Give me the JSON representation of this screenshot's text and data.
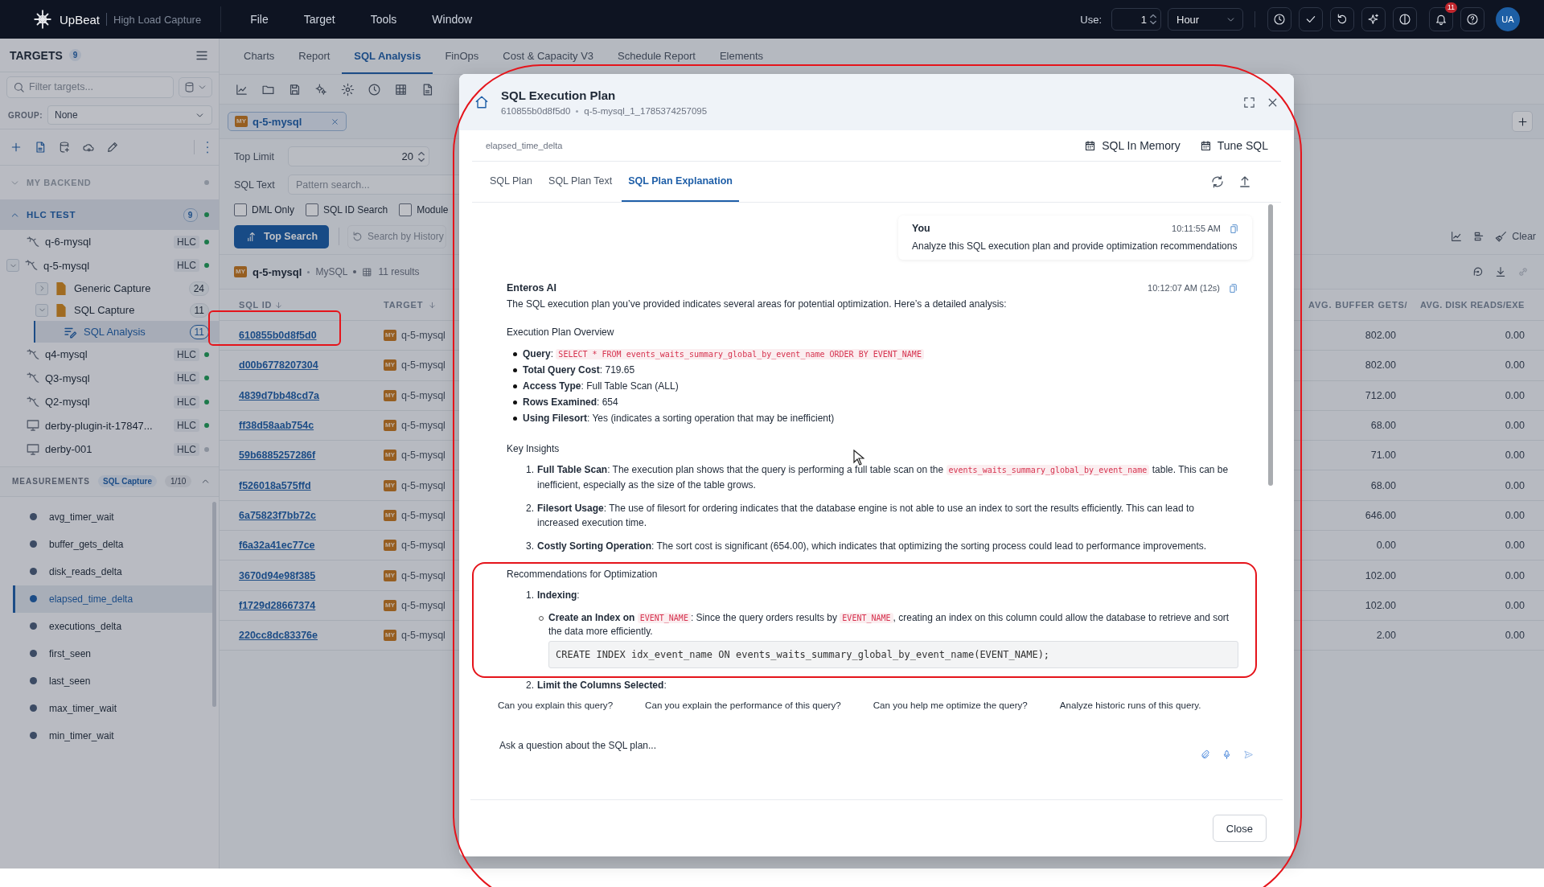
{
  "app": {
    "name": "UpBeat",
    "subtitle": "High Load Capture",
    "menu": [
      "File",
      "Target",
      "Tools",
      "Window"
    ]
  },
  "top_bar": {
    "use_label": "Use:",
    "use_value": "1",
    "unit": "Hour",
    "notifications": "11",
    "avatar": "UA"
  },
  "sidebar": {
    "title": "TARGETS",
    "count": "9",
    "filter_placeholder": "Filter targets...",
    "group_label": "GROUP:",
    "group_value": "None",
    "sections": [
      {
        "label": "MY BACKEND",
        "expanded": false,
        "online": false
      },
      {
        "label": "HLC TEST",
        "expanded": true,
        "count": "9",
        "online": true,
        "targets": [
          {
            "kind": "mysql",
            "name": "q-6-mysql",
            "badge": "HLC",
            "online": true
          },
          {
            "kind": "mysql",
            "name": "q-5-mysql",
            "badge": "HLC",
            "online": true,
            "expanded": true,
            "children": [
              {
                "kind": "capture",
                "name": "Generic Capture",
                "count": "24",
                "expanded": false
              },
              {
                "kind": "capture",
                "name": "SQL Capture",
                "count": "11",
                "expanded": true,
                "children": [
                  {
                    "kind": "analysis",
                    "name": "SQL Analysis",
                    "count": "11",
                    "selected": true
                  }
                ]
              }
            ]
          },
          {
            "kind": "mysql",
            "name": "q4-mysql",
            "badge": "HLC",
            "online": true
          },
          {
            "kind": "mysql",
            "name": "Q3-mysql",
            "badge": "HLC",
            "online": true
          },
          {
            "kind": "mysql",
            "name": "Q2-mysql",
            "badge": "HLC",
            "online": true
          },
          {
            "kind": "monitor",
            "name": "derby-plugin-it-17847...",
            "badge": "HLC",
            "online": true
          },
          {
            "kind": "monitor",
            "name": "derby-001",
            "badge": "HLC",
            "online": false
          }
        ]
      }
    ]
  },
  "measurements": {
    "label": "MEASUREMENTS",
    "capture": "SQL Capture",
    "count": "1/10",
    "items": [
      {
        "name": "avg_timer_wait",
        "selected": false
      },
      {
        "name": "buffer_gets_delta",
        "selected": false
      },
      {
        "name": "disk_reads_delta",
        "selected": false
      },
      {
        "name": "elapsed_time_delta",
        "selected": true
      },
      {
        "name": "executions_delta",
        "selected": false
      },
      {
        "name": "first_seen",
        "selected": false
      },
      {
        "name": "last_seen",
        "selected": false
      },
      {
        "name": "max_timer_wait",
        "selected": false
      },
      {
        "name": "min_timer_wait",
        "selected": false
      }
    ]
  },
  "tabs": [
    {
      "label": "Charts",
      "selected": false
    },
    {
      "label": "Report",
      "selected": false
    },
    {
      "label": "SQL Analysis",
      "selected": true
    },
    {
      "label": "FinOps",
      "selected": false
    },
    {
      "label": "Cost & Capacity V3",
      "selected": false
    },
    {
      "label": "Schedule Report",
      "selected": false
    },
    {
      "label": "Elements",
      "selected": false
    }
  ],
  "query_tag": {
    "db": "MY",
    "name": "q-5-mysql"
  },
  "filters": {
    "top_limit_label": "Top Limit",
    "top_limit": "20",
    "sql_text_label": "SQL Text",
    "sql_text_placeholder": "Pattern search...",
    "checkboxes": [
      {
        "label": "DML Only",
        "checked": false
      },
      {
        "label": "SQL ID Search",
        "checked": false
      },
      {
        "label": "Module",
        "checked": false
      }
    ],
    "search_button": "Top Search",
    "history_button": "Search by History",
    "clear_button": "Clear"
  },
  "results": {
    "db": "MY",
    "target": "q-5-mysql",
    "engine": "MySQL",
    "count": "11 results",
    "columns": [
      "SQL ID",
      "TARGET",
      "AVG. BUFFER GETS/",
      "AVG. DISK READS/EXE"
    ],
    "rows": [
      {
        "sql_id": "610855b0d8f5d0",
        "db": "MY",
        "target": "q-5-mysql",
        "avg_buffer_gets": "802.00",
        "avg_disk_reads": "0.00"
      },
      {
        "sql_id": "d00b6778207304",
        "db": "MY",
        "target": "q-5-mysql",
        "avg_buffer_gets": "802.00",
        "avg_disk_reads": "0.00"
      },
      {
        "sql_id": "4839d7bb48cd7a",
        "db": "MY",
        "target": "q-5-mysql",
        "avg_buffer_gets": "712.00",
        "avg_disk_reads": "0.00"
      },
      {
        "sql_id": "ff38d58aab754c",
        "db": "MY",
        "target": "q-5-mysql",
        "avg_buffer_gets": "68.00",
        "avg_disk_reads": "0.00"
      },
      {
        "sql_id": "59b6885257286f",
        "db": "MY",
        "target": "q-5-mysql",
        "avg_buffer_gets": "71.00",
        "avg_disk_reads": "0.00"
      },
      {
        "sql_id": "f526018a575ffd",
        "db": "MY",
        "target": "q-5-mysql",
        "avg_buffer_gets": "68.00",
        "avg_disk_reads": "0.00"
      },
      {
        "sql_id": "6a75823f7bb72c",
        "db": "MY",
        "target": "q-5-mysql",
        "avg_buffer_gets": "646.00",
        "avg_disk_reads": "0.00"
      },
      {
        "sql_id": "f6a32a41ec77ce",
        "db": "MY",
        "target": "q-5-mysql",
        "avg_buffer_gets": "0.00",
        "avg_disk_reads": "0.00"
      },
      {
        "sql_id": "3670d94e98f385",
        "db": "MY",
        "target": "q-5-mysql",
        "avg_buffer_gets": "102.00",
        "avg_disk_reads": "0.00"
      },
      {
        "sql_id": "f1729d28667374",
        "db": "MY",
        "target": "q-5-mysql",
        "avg_buffer_gets": "102.00",
        "avg_disk_reads": "0.00"
      },
      {
        "sql_id": "220cc8dc83376e",
        "db": "MY",
        "target": "q-5-mysql",
        "avg_buffer_gets": "2.00",
        "avg_disk_reads": "0.00"
      }
    ]
  },
  "modal": {
    "title": "SQL Execution Plan",
    "sql_id": "610855b0d8f5d0",
    "source": "q-5-mysql_1_1785374257095",
    "metric": "elapsed_time_delta",
    "actions": [
      "SQL In Memory",
      "Tune SQL"
    ],
    "tabs": [
      {
        "label": "SQL Plan",
        "selected": false
      },
      {
        "label": "SQL Plan Text",
        "selected": false
      },
      {
        "label": "SQL Plan Explanation",
        "selected": true
      }
    ],
    "messages": [
      {
        "kind": "user",
        "author": "You",
        "time": "10:11:55 AM",
        "text": "Analyze this SQL execution plan and provide optimization recommendations"
      },
      {
        "kind": "ai",
        "author": "Enteros AI",
        "time": "10:12:07 AM (12s)",
        "blocks": [
          {
            "kind": "paragraph",
            "text": "The SQL execution plan you’ve provided indicates several areas for potential optimization. Here’s a detailed analysis:"
          },
          {
            "kind": "heading",
            "text": "Execution Plan Overview"
          },
          {
            "kind": "bullets",
            "items": [
              [
                {
                  "kind": "bold",
                  "text": "Query"
                },
                {
                  "kind": "plain",
                  "text": ": "
                },
                {
                  "kind": "code",
                  "text": "SELECT * FROM events_waits_summary_global_by_event_name ORDER BY EVENT_NAME"
                }
              ],
              [
                {
                  "kind": "bold",
                  "text": "Total Query Cost"
                },
                {
                  "kind": "plain",
                  "text": ": 719.65"
                }
              ],
              [
                {
                  "kind": "bold",
                  "text": "Access Type"
                },
                {
                  "kind": "plain",
                  "text": ": Full Table Scan (ALL)"
                }
              ],
              [
                {
                  "kind": "bold",
                  "text": "Rows Examined"
                },
                {
                  "kind": "plain",
                  "text": ": 654"
                }
              ],
              [
                {
                  "kind": "bold",
                  "text": "Using Filesort"
                },
                {
                  "kind": "plain",
                  "text": ": Yes (indicates a sorting operation that may be inefficient)"
                }
              ]
            ]
          },
          {
            "kind": "heading",
            "text": "Key Insights"
          },
          {
            "kind": "numbered",
            "items": [
              {
                "number": "1.",
                "segments": [
                  {
                    "kind": "bold",
                    "text": "Full Table Scan"
                  },
                  {
                    "kind": "plain",
                    "text": ": The execution plan shows that the query is performing a full table scan on the "
                  },
                  {
                    "kind": "code",
                    "text": "events_waits_summary_global_by_event_name"
                  },
                  {
                    "kind": "plain",
                    "text": " table. This can be inefficient, especially as the size of the table grows."
                  }
                ]
              },
              {
                "number": "2.",
                "segments": [
                  {
                    "kind": "bold",
                    "text": "Filesort Usage"
                  },
                  {
                    "kind": "plain",
                    "text": ": The use of filesort for ordering indicates that the database engine is not able to use an index to sort the results efficiently. This can lead to increased execution time."
                  }
                ]
              },
              {
                "number": "3.",
                "segments": [
                  {
                    "kind": "bold",
                    "text": "Costly Sorting Operation"
                  },
                  {
                    "kind": "plain",
                    "text": ": The sort cost is significant (654.00), which indicates that optimizing the sorting process could lead to performance improvements."
                  }
                ]
              }
            ]
          },
          {
            "kind": "heading",
            "text": "Recommendations for Optimization"
          },
          {
            "kind": "numbered",
            "items": [
              {
                "number": "1.",
                "segments": [
                  {
                    "kind": "bold",
                    "text": "Indexing"
                  },
                  {
                    "kind": "plain",
                    "text": ":"
                  }
                ],
                "children": [
                  {
                    "kind": "sub_bullet",
                    "segments": [
                      {
                        "kind": "bold",
                        "text": "Create an Index on "
                      },
                      {
                        "kind": "code",
                        "text": "EVENT_NAME"
                      },
                      {
                        "kind": "plain",
                        "text": ": Since the query orders results by "
                      },
                      {
                        "kind": "code",
                        "text": "EVENT_NAME"
                      },
                      {
                        "kind": "plain",
                        "text": ", creating an index on this column could allow the database to retrieve and sort the data more efficiently."
                      }
                    ]
                  },
                  {
                    "kind": "code_block",
                    "text": "CREATE INDEX idx_event_name ON events_waits_summary_global_by_event_name(EVENT_NAME);"
                  }
                ]
              },
              {
                "number": "2.",
                "segments": [
                  {
                    "kind": "bold",
                    "text": "Limit the Columns Selected"
                  },
                  {
                    "kind": "plain",
                    "text": ":"
                  }
                ]
              }
            ]
          }
        ]
      }
    ],
    "suggestions": [
      "Can you explain this query?",
      "Can you explain the performance of this query?",
      "Can you help me optimize the query?",
      "Analyze historic runs of this query."
    ],
    "input_placeholder": "Ask a question about the SQL plan...",
    "close": "Close"
  }
}
